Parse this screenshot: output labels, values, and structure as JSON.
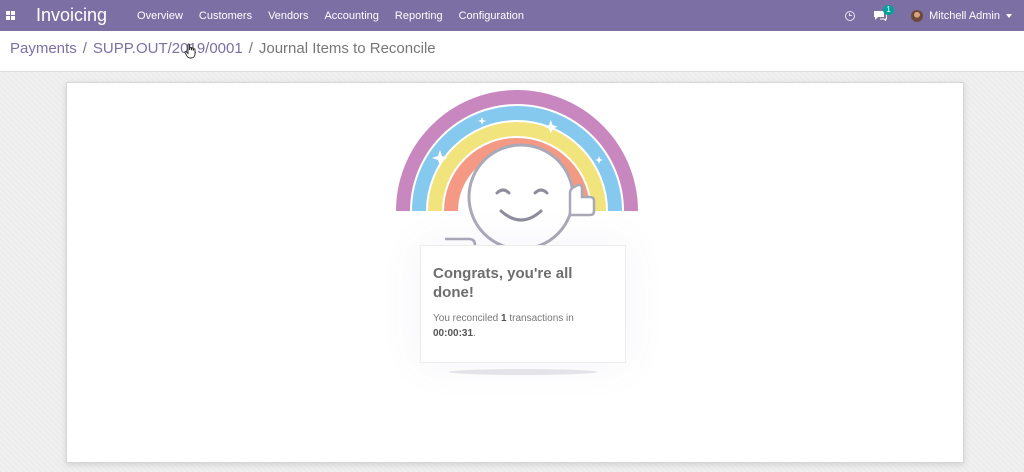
{
  "navbar": {
    "app_name": "Invoicing",
    "menu": [
      "Overview",
      "Customers",
      "Vendors",
      "Accounting",
      "Reporting",
      "Configuration"
    ],
    "chat_count": "1",
    "user_name": "Mitchell Admin",
    "bg_color": "#7c6fa4"
  },
  "breadcrumb": {
    "items": [
      "Payments",
      "SUPP.OUT/2019/0001"
    ],
    "separator": "/",
    "current": "Journal Items to Reconcile"
  },
  "result": {
    "title": "Congrats, you're all done!",
    "text_before": "You reconciled ",
    "count": "1",
    "text_middle": " transactions in ",
    "duration": "00:00:31",
    "text_after": "."
  },
  "icons": {
    "apps": "apps-grid-icon",
    "clock": "clock-icon",
    "chat": "chat-icon",
    "cursor": "hand-cursor-icon",
    "illustration": "rainbow-smiley-icon"
  }
}
